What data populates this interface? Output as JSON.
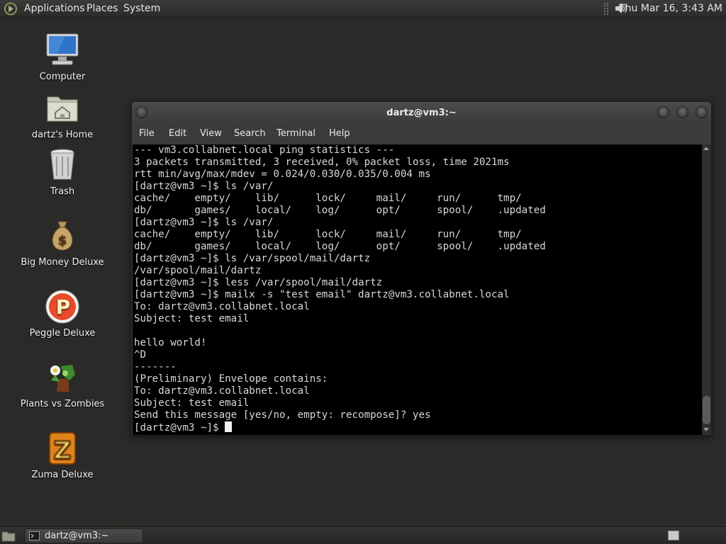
{
  "top_panel": {
    "menus": [
      "Applications",
      "Places",
      "System"
    ],
    "clock": "Thu Mar 16,  3:43 AM"
  },
  "desktop_icons": [
    {
      "label": "Computer",
      "icon": "computer-icon"
    },
    {
      "label": "dartz's Home",
      "icon": "home-folder-icon"
    },
    {
      "label": "Trash",
      "icon": "trash-icon"
    },
    {
      "label": "Big Money Deluxe",
      "icon": "money-bag-icon"
    },
    {
      "label": "Peggle Deluxe",
      "icon": "peggle-icon"
    },
    {
      "label": "Plants vs Zombies",
      "icon": "plants-vs-zombies-icon"
    },
    {
      "label": "Zuma Deluxe",
      "icon": "zuma-icon"
    }
  ],
  "window": {
    "title": "dartz@vm3:~",
    "menu": [
      "File",
      "Edit",
      "View",
      "Search",
      "Terminal",
      "Help"
    ]
  },
  "terminal_lines": [
    "--- vm3.collabnet.local ping statistics ---",
    "3 packets transmitted, 3 received, 0% packet loss, time 2021ms",
    "rtt min/avg/max/mdev = 0.024/0.030/0.035/0.004 ms",
    "[dartz@vm3 ~]$ ls /var/",
    "cache/    empty/    lib/      lock/     mail/     run/      tmp/",
    "db/       games/    local/    log/      opt/      spool/    .updated",
    "[dartz@vm3 ~]$ ls /var/",
    "cache/    empty/    lib/      lock/     mail/     run/      tmp/",
    "db/       games/    local/    log/      opt/      spool/    .updated",
    "[dartz@vm3 ~]$ ls /var/spool/mail/dartz",
    "/var/spool/mail/dartz",
    "[dartz@vm3 ~]$ less /var/spool/mail/dartz",
    "[dartz@vm3 ~]$ mailx -s \"test email\" dartz@vm3.collabnet.local",
    "To: dartz@vm3.collabnet.local",
    "Subject: test email",
    "",
    "hello world!",
    "^D",
    "-------",
    "(Preliminary) Envelope contains:",
    "To: dartz@vm3.collabnet.local",
    "Subject: test email",
    "Send this message [yes/no, empty: recompose]? yes"
  ],
  "terminal_prompt": "[dartz@vm3 ~]$ ",
  "taskbar": {
    "task_label": "dartz@vm3:~"
  }
}
